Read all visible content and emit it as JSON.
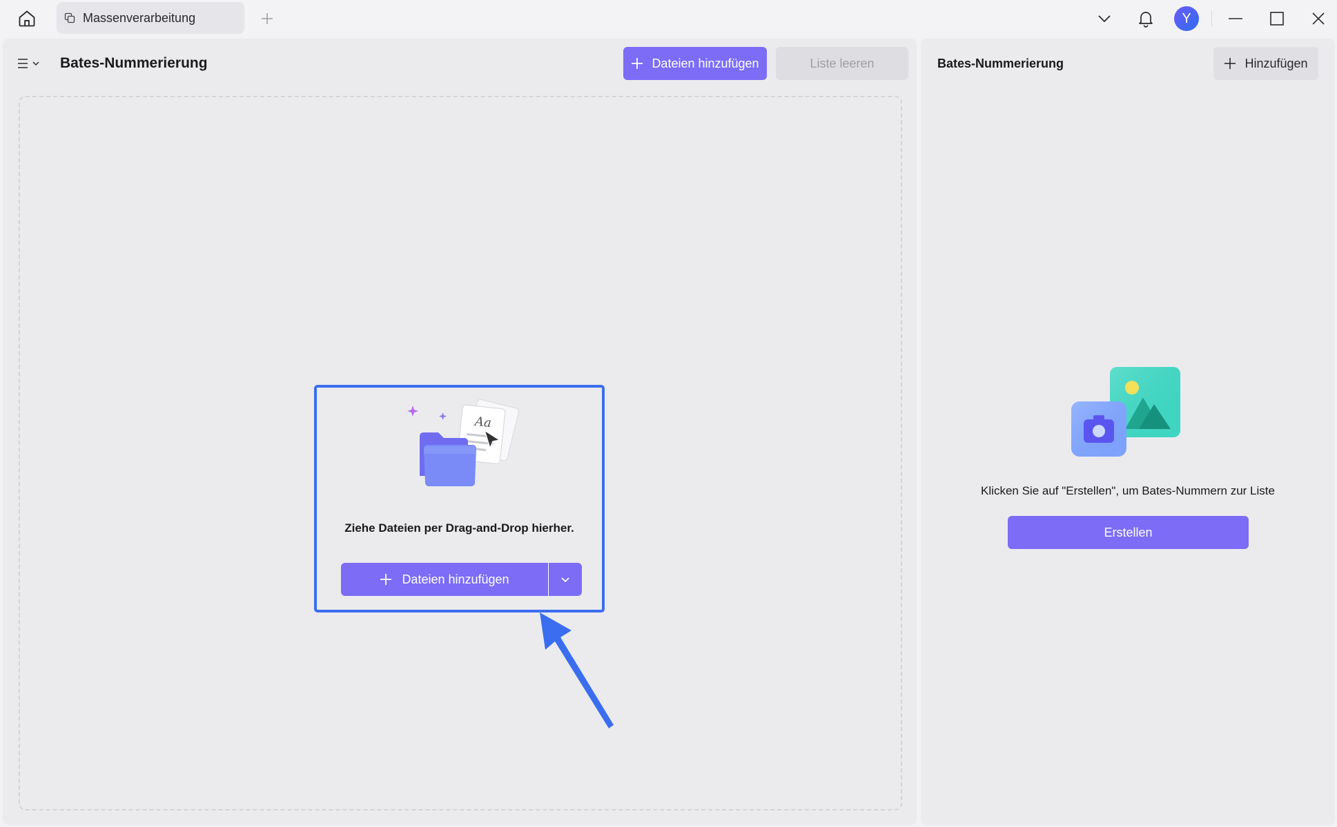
{
  "titlebar": {
    "tab_title": "Massenverarbeitung",
    "avatar_letter": "Y"
  },
  "left_panel": {
    "title": "Bates-Nummerierung",
    "add_files_label": "Dateien hinzufügen",
    "clear_list_label": "Liste leeren",
    "drop_text": "Ziehe Dateien per Drag-and-Drop hierher.",
    "drop_add_files_label": "Dateien hinzufügen"
  },
  "right_panel": {
    "title": "Bates-Nummerierung",
    "add_label": "Hinzufügen",
    "empty_text": "Klicken Sie auf \"Erstellen\", um Bates-Nummern zur Liste",
    "create_label": "Erstellen"
  },
  "icons": {
    "home": "home-icon",
    "tab": "copy-icon",
    "new_tab": "plus-icon",
    "expand": "chevron-down-icon",
    "notifications": "bell-icon",
    "minimize": "minimize-icon",
    "maximize": "maximize-icon",
    "close": "close-icon",
    "menu": "hamburger-icon"
  },
  "colors": {
    "accent": "#7c6cf6",
    "highlight": "#3b6df0",
    "arrow": "#3b6df0",
    "panel_bg": "#ebebee",
    "disabled_text": "#9d9da4"
  }
}
